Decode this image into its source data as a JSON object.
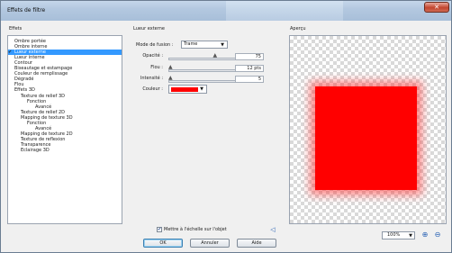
{
  "window": {
    "title": "Effets de filtre",
    "close_glyph": "✕"
  },
  "effects_panel": {
    "label": "Effets",
    "items": [
      {
        "label": "Ombre portée",
        "indent": 1,
        "selected": false
      },
      {
        "label": "Ombre interne",
        "indent": 1,
        "selected": false
      },
      {
        "label": "Lueur externe",
        "indent": 1,
        "selected": true
      },
      {
        "label": "Lueur interne",
        "indent": 1,
        "selected": false
      },
      {
        "label": "Contour",
        "indent": 1,
        "selected": false
      },
      {
        "label": "Biseautage et estampage",
        "indent": 1,
        "selected": false
      },
      {
        "label": "Couleur de remplissage",
        "indent": 1,
        "selected": false
      },
      {
        "label": "Dégradé",
        "indent": 1,
        "selected": false
      },
      {
        "label": "Flou",
        "indent": 1,
        "selected": false
      },
      {
        "label": "Effets 3D",
        "indent": 1,
        "selected": false
      },
      {
        "label": "Texture de relief 3D",
        "indent": 2,
        "selected": false
      },
      {
        "label": "Fonction",
        "indent": 3,
        "selected": false
      },
      {
        "label": "Avancé",
        "indent": 4,
        "selected": false
      },
      {
        "label": "Texture de relief 2D",
        "indent": 2,
        "selected": false
      },
      {
        "label": "Mapping de texture 3D",
        "indent": 2,
        "selected": false
      },
      {
        "label": "Fonction",
        "indent": 3,
        "selected": false
      },
      {
        "label": "Avancé",
        "indent": 4,
        "selected": false
      },
      {
        "label": "Mapping de texture 2D",
        "indent": 2,
        "selected": false
      },
      {
        "label": "Texture de reflexion",
        "indent": 2,
        "selected": false
      },
      {
        "label": "Transparence",
        "indent": 2,
        "selected": false
      },
      {
        "label": "Eclairage 3D",
        "indent": 2,
        "selected": false
      }
    ],
    "checkmark": "✔"
  },
  "settings": {
    "section_label": "Lueur externe",
    "blend_mode": {
      "label": "Mode de fusion :",
      "value": "Trame"
    },
    "opacity": {
      "label": "Opacité :",
      "value": "75",
      "level": 0.75
    },
    "blur": {
      "label": "Flou :",
      "value": "12 pts",
      "level": 0.0
    },
    "intensity": {
      "label": "Intensité :",
      "value": "5",
      "level": 0.0
    },
    "color": {
      "label": "Couleur :",
      "value": "#ff0000"
    }
  },
  "preview": {
    "label": "Aperçu",
    "zoom": "100%",
    "zoom_in_icon": "zoom-in-icon",
    "zoom_out_icon": "zoom-out-icon"
  },
  "footer": {
    "scale_checkbox_label": "Mettre à l'échelle sur l'objet",
    "scale_checked": true,
    "ok": "OK",
    "cancel": "Annuler",
    "help": "Aide"
  }
}
